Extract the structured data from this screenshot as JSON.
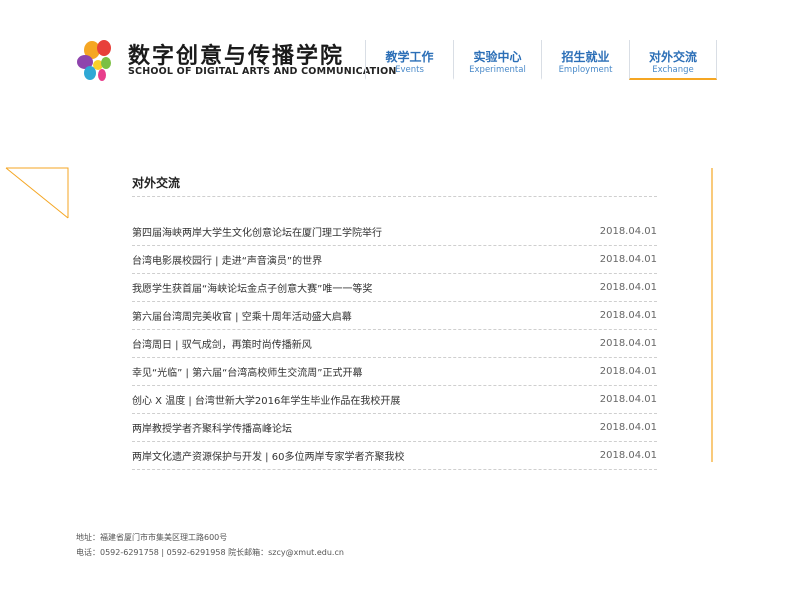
{
  "header": {
    "logo_cn": "数字创意与传播学院",
    "logo_en": "SCHOOL OF DIGITAL ARTS AND COMMUNICATION"
  },
  "nav": [
    {
      "cn": "教学工作",
      "en": "Events"
    },
    {
      "cn": "实验中心",
      "en": "Experimental"
    },
    {
      "cn": "招生就业",
      "en": "Employment"
    },
    {
      "cn": "对外交流",
      "en": "Exchange"
    }
  ],
  "section": {
    "title": "对外交流"
  },
  "news": [
    {
      "title": "第四届海峡两岸大学生文化创意论坛在厦门理工学院举行",
      "date": "2018.04.01"
    },
    {
      "title": "台湾电影展校园行 | 走进“声音演员”的世界",
      "date": "2018.04.01"
    },
    {
      "title": "我愿学生获首届“海峡论坛金点子创意大赛”唯一一等奖",
      "date": "2018.04.01"
    },
    {
      "title": "第六届台湾周完美收官 | 空乘十周年活动盛大启幕",
      "date": "2018.04.01"
    },
    {
      "title": "台湾周日 | 驭气成剑，再策时尚传播新风",
      "date": "2018.04.01"
    },
    {
      "title": "幸见“光临” | 第六届“台湾高校师生交流周”正式开幕",
      "date": "2018.04.01"
    },
    {
      "title": "创心 X 温度 | 台湾世新大学2016年学生毕业作品在我校开展",
      "date": "2018.04.01"
    },
    {
      "title": "两岸教授学者齐聚科学传播高峰论坛",
      "date": "2018.04.01"
    },
    {
      "title": "两岸文化遗产资源保护与开发 | 60多位两岸专家学者齐聚我校",
      "date": "2018.04.01"
    }
  ],
  "footer": {
    "address": "地址：福建省厦门市市集美区理工路600号",
    "contact": "电话：0592-6291758 | 0592-6291958  院长邮箱：szcy@xmut.edu.cn"
  },
  "colors": {
    "accent": "#f5a623",
    "nav_text": "#2c6fb7"
  }
}
